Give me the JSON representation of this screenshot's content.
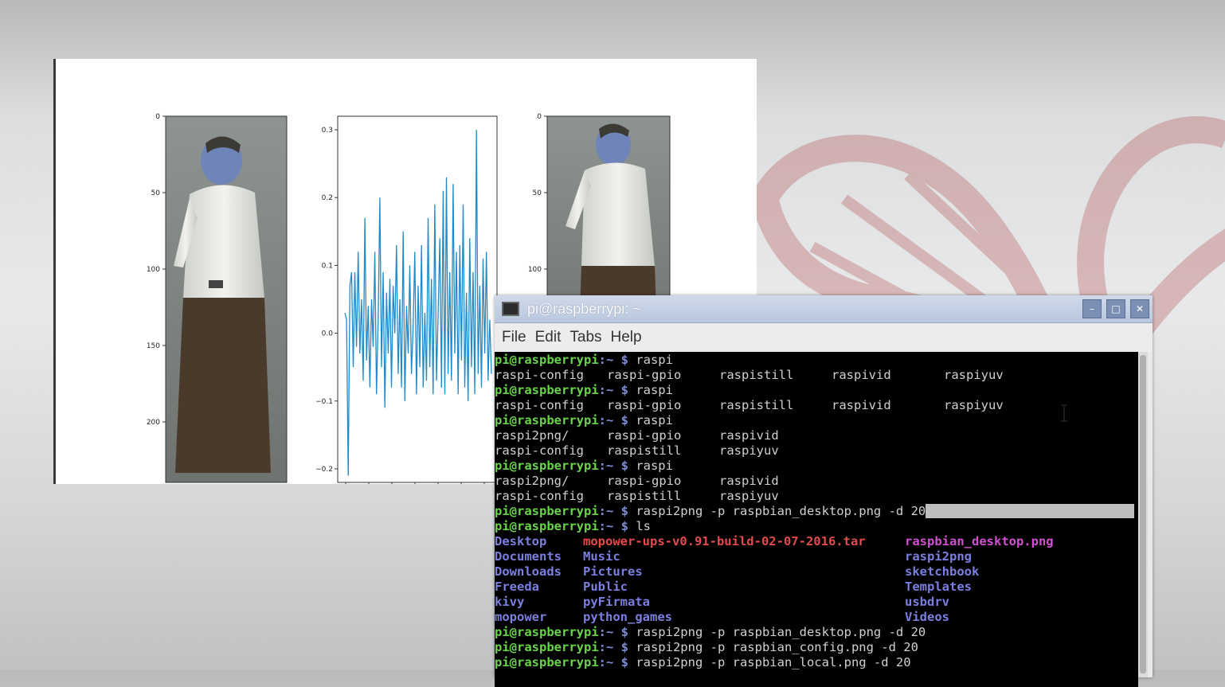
{
  "figure": {
    "left_image": {
      "yticks": [
        "0",
        "50",
        "100",
        "150",
        "200"
      ]
    },
    "line_plot": {
      "yticks": [
        "0.3",
        "0.2",
        "0.1",
        "0.0",
        "−0.1",
        "−0.2"
      ],
      "ylim": [
        -0.22,
        0.32
      ]
    },
    "right_image": {
      "yticks": [
        "0",
        "50",
        "100"
      ]
    }
  },
  "chart_data": {
    "type": "line",
    "ylim": [
      -0.22,
      0.32
    ],
    "values": [
      0.03,
      0.02,
      -0.21,
      0.07,
      0.09,
      -0.05,
      0.09,
      -0.02,
      0.12,
      -0.03,
      0.05,
      -0.07,
      0.17,
      -0.04,
      0.04,
      -0.08,
      0.05,
      -0.02,
      0.12,
      -0.09,
      0.02,
      0.2,
      -0.05,
      0.09,
      -0.11,
      0.06,
      -0.03,
      0.08,
      -0.08,
      0.07,
      0.0,
      0.13,
      -0.06,
      0.05,
      -0.08,
      0.15,
      -0.1,
      0.04,
      -0.03,
      0.1,
      -0.06,
      0.01,
      0.12,
      -0.09,
      0.07,
      -0.05,
      0.13,
      -0.08,
      0.03,
      -0.07,
      0.17,
      -0.05,
      0.08,
      -0.09,
      0.19,
      -0.07,
      0.03,
      0.14,
      -0.08,
      0.21,
      -0.09,
      0.23,
      -0.06,
      0.09,
      -0.07,
      0.22,
      -0.03,
      0.12,
      -0.09,
      0.13,
      -0.04,
      0.19,
      -0.08,
      0.06,
      -0.1,
      0.14,
      -0.05,
      0.09,
      -0.09,
      0.3,
      -0.06,
      0.07,
      -0.08,
      0.11,
      -0.03,
      0.12,
      -0.07,
      0.02,
      -0.06
    ]
  },
  "terminal": {
    "title": "pi@raspberrypi: ~",
    "buttons": {
      "minimize": "–",
      "maximize": "□",
      "close": "✕"
    },
    "menu": [
      "File",
      "Edit",
      "Tabs",
      "Help"
    ],
    "prompt_user": "pi@raspberrypi",
    "prompt_path": ":~ $",
    "lines": [
      {
        "cmd": " raspi"
      },
      {
        "cols": [
          "raspi-config",
          "raspi-gpio",
          "raspistill",
          "raspivid",
          "raspiyuv"
        ]
      },
      {
        "cmd": " raspi"
      },
      {
        "cols": [
          "raspi-config",
          "raspi-gpio",
          "raspistill",
          "raspivid",
          "raspiyuv"
        ]
      },
      {
        "cmd": " raspi"
      },
      {
        "cols": [
          "raspi2png/",
          "raspi-gpio",
          "raspivid"
        ]
      },
      {
        "cols": [
          "raspi-config",
          "raspistill",
          "raspiyuv"
        ]
      },
      {
        "cmd": " raspi"
      },
      {
        "cols": [
          "raspi2png/",
          "raspi-gpio",
          "raspivid"
        ]
      },
      {
        "cols": [
          "raspi-config",
          "raspistill",
          "raspiyuv"
        ]
      },
      {
        "cmd": " raspi2png -p raspbian_desktop.png -d 20",
        "selected": true
      },
      {
        "cmd": " ls"
      }
    ],
    "ls": [
      [
        "Desktop",
        "mopower-ups-v0.91-build-02-07-2016.tar",
        "raspbian_desktop.png"
      ],
      [
        "Documents",
        "Music",
        "raspi2png"
      ],
      [
        "Downloads",
        "Pictures",
        "sketchbook"
      ],
      [
        "Freeda",
        "Public",
        "Templates"
      ],
      [
        "kivy",
        "pyFirmata",
        "usbdrv"
      ],
      [
        "mopower",
        "python_games",
        "Videos"
      ]
    ],
    "after": [
      " raspi2png -p raspbian_desktop.png -d 20",
      " raspi2png -p raspbian_config.png -d 20",
      " raspi2png -p raspbian_local.png -d 20"
    ]
  }
}
